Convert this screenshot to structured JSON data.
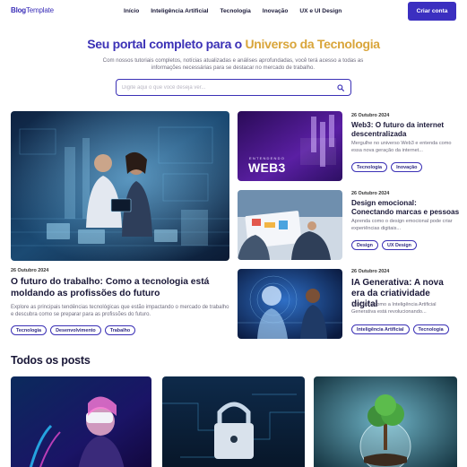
{
  "header": {
    "logo_bold": "Blog",
    "logo_light": "Template",
    "nav": [
      "Início",
      "Inteligência Artificial",
      "Tecnologia",
      "Inovação",
      "UX e UI Design"
    ],
    "cta": "Criar conta"
  },
  "hero": {
    "title_part1": "Seu portal completo para o ",
    "title_part2": "Universo da Tecnologia",
    "subtitle": "Com nossos tutoriais completos, notícias atualizadas e análises aprofundadas, você terá acesso a todas as informações necessárias para se destacar no mercado de trabalho.",
    "search_placeholder": "Digite aqui o que você deseja ver..."
  },
  "featured": {
    "main": {
      "date": "26 Outubro 2024",
      "title": "O futuro do trabalho: Como a tecnologia está moldando as profissões do futuro",
      "description": "Explore as principais tendências tecnológicas que estão impactando o mercado de trabalho e descubra como se preparar para as profissões do futuro.",
      "tags": [
        "Tecnologia",
        "Desenvolvimento",
        "Trabalho"
      ]
    },
    "side": [
      {
        "date": "26 Outubro 2024",
        "title": "Web3: O futuro da internet descentralizada",
        "description": "Mergulhe no universo Web3 e entenda como essa nova geração da internet...",
        "tags": [
          "Tecnologia",
          "Inovação"
        ],
        "image_caption_small": "ENTENDENDO",
        "image_caption_big": "WEB3"
      },
      {
        "date": "26 Outubro 2024",
        "title": "Design emocional: Conectando marcas e pessoas",
        "description": "Aprenda como o design emocional pode criar experiências digitais...",
        "tags": [
          "Design",
          "UX Design"
        ]
      },
      {
        "date": "26 Outubro 2024",
        "title": "IA Generativa: A nova era da criatividade digital",
        "description": "Descubra como a Inteligência Artificial Generativa está revolucionando...",
        "tags": [
          "Inteligência Artificial",
          "Tecnologia"
        ]
      }
    ]
  },
  "all_posts": {
    "title": "Todos os posts"
  },
  "colors": {
    "brand": "#3b2fc0",
    "accent_gold": "#d9a53a",
    "text_dark": "#1a1838",
    "text_muted": "#6e6c7e"
  },
  "icons": {
    "search": "search-icon"
  }
}
